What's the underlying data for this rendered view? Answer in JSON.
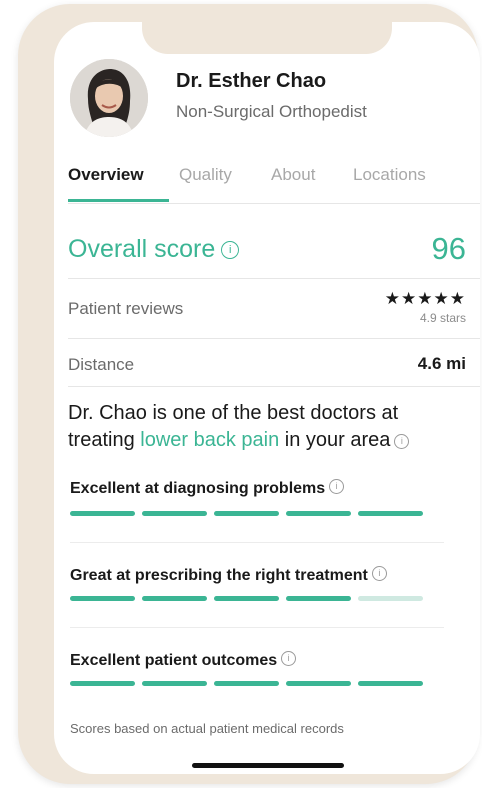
{
  "doctor": {
    "name": "Dr. Esther Chao",
    "specialty": "Non-Surgical Orthopedist"
  },
  "tabs": [
    {
      "label": "Overview",
      "active": true
    },
    {
      "label": "Quality",
      "active": false
    },
    {
      "label": "About",
      "active": false
    },
    {
      "label": "Locations",
      "active": false
    }
  ],
  "overall": {
    "label": "Overall score",
    "value": "96",
    "info_icon": "info-circle-icon"
  },
  "reviews": {
    "label": "Patient reviews",
    "stars_glyphs": "★★★★★",
    "rating": 4.9,
    "caption": "4.9 stars"
  },
  "distance": {
    "label": "Distance",
    "value": "4.6 mi"
  },
  "summary": {
    "prefix": "Dr. Chao is one of the best doctors at treating ",
    "highlight": "lower back pain",
    "suffix": " in your area"
  },
  "criteria": [
    {
      "label": "Excellent at diagnosing problems",
      "filled": 5,
      "total": 5
    },
    {
      "label": "Great at prescribing the right treatment",
      "filled": 4,
      "total": 5
    },
    {
      "label": "Excellent patient outcomes",
      "filled": 5,
      "total": 5
    }
  ],
  "footnote": "Scores based on actual patient medical records",
  "colors": {
    "accent": "#3bb594",
    "bar_empty": "#cfe9e1",
    "frame": "#efe6da",
    "text_primary": "#1a1a1a",
    "text_secondary": "#6b6b6b"
  }
}
